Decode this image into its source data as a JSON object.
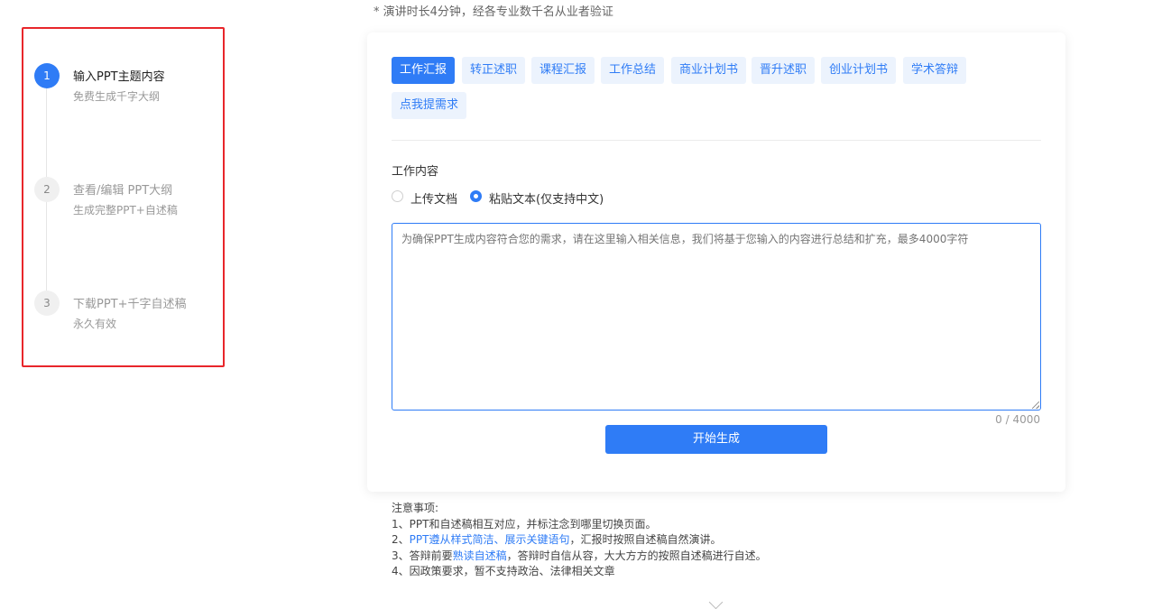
{
  "top_note": "* 演讲时长4分钟，经各专业数千名从业者验证",
  "steps": [
    {
      "number": "1",
      "title": "输入PPT主题内容",
      "subtitle": "免费生成千字大纲"
    },
    {
      "number": "2",
      "title": "查看/编辑 PPT大纲",
      "subtitle": "生成完整PPT+自述稿"
    },
    {
      "number": "3",
      "title": "下载PPT+千字自述稿",
      "subtitle": "永久有效"
    }
  ],
  "tabs": [
    "工作汇报",
    "转正述职",
    "课程汇报",
    "工作总结",
    "商业计划书",
    "晋升述职",
    "创业计划书",
    "学术答辩",
    "点我提需求"
  ],
  "active_tab": "工作汇报",
  "field_label": "工作内容",
  "radio_options": [
    "上传文档",
    "粘贴文本(仅支持中文)"
  ],
  "selected_radio": "粘贴文本(仅支持中文)",
  "textarea_placeholder": "为确保PPT生成内容符合您的需求，请在这里输入相关信息，我们将基于您输入的内容进行总结和扩充，最多4000字符",
  "counter": "0 / 4000",
  "generate_button": "开始生成",
  "notes": {
    "title": "注意事项:",
    "line1": "1、PPT和自述稿相互对应，并标注念到哪里切换页面。",
    "line2_prefix": "2、",
    "line2_highlight": "PPT遵从样式简洁、展示关键语句",
    "line2_suffix": "，汇报时按照自述稿自然演讲。",
    "line3_prefix": "3、答辩前要",
    "line3_highlight": "熟读自述稿",
    "line3_suffix": "，答辩时自信从容，大大方方的按照自述稿进行自述。",
    "line4": "4、因政策要求，暂不支持政治、法律相关文章"
  },
  "colors": {
    "accent": "#2f7cf6",
    "highlight_box": "#e8262b",
    "tab_bg": "#ecf3fd"
  }
}
